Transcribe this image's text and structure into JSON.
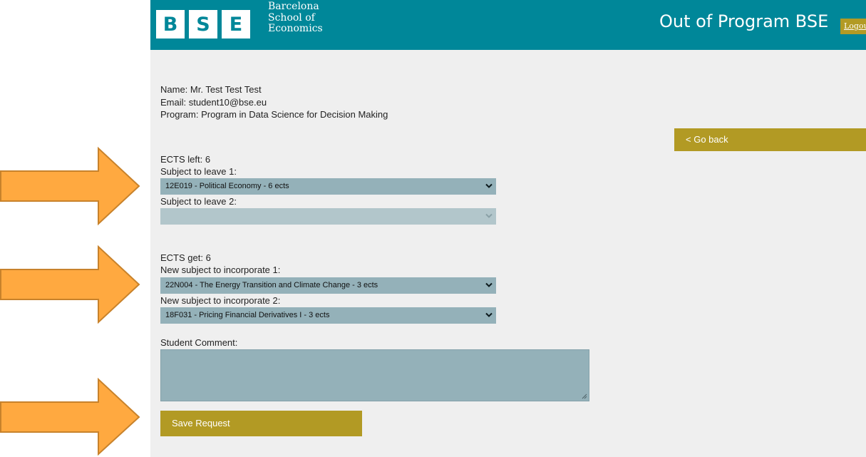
{
  "header": {
    "logo_letters": [
      "B",
      "S",
      "E"
    ],
    "logo_text": [
      "Barcelona",
      "School of",
      "Economics"
    ],
    "app_title": "Out of Program BSE",
    "logout_label": "Logout"
  },
  "student": {
    "name_line": "Name: Mr. Test Test Test",
    "email_line": "Email: student10@bse.eu",
    "program_line": "Program: Program in Data Science for Decision Making"
  },
  "go_back_label": "< Go back",
  "leave": {
    "ects_line": "ECTS left: 6",
    "subject1_label": "Subject to leave 1:",
    "subject1_value": "12E019 - Political Economy - 6 ects",
    "subject2_label": "Subject to leave 2:",
    "subject2_value": ""
  },
  "incorporate": {
    "ects_line": "ECTS get: 6",
    "subject1_label": "New subject to incorporate 1:",
    "subject1_value": "22N004 - The Energy Transition and Climate Change - 3 ects",
    "subject2_label": "New subject to incorporate 2:",
    "subject2_value": "18F031 - Pricing Financial Derivatives I - 3 ects"
  },
  "comment": {
    "label": "Student Comment:",
    "value": ""
  },
  "save_label": "Save Request",
  "colors": {
    "header_teal": "#008799",
    "gold": "#b29a24",
    "select_bg": "#94b1b9",
    "arrow_orange": "#ffa940"
  }
}
